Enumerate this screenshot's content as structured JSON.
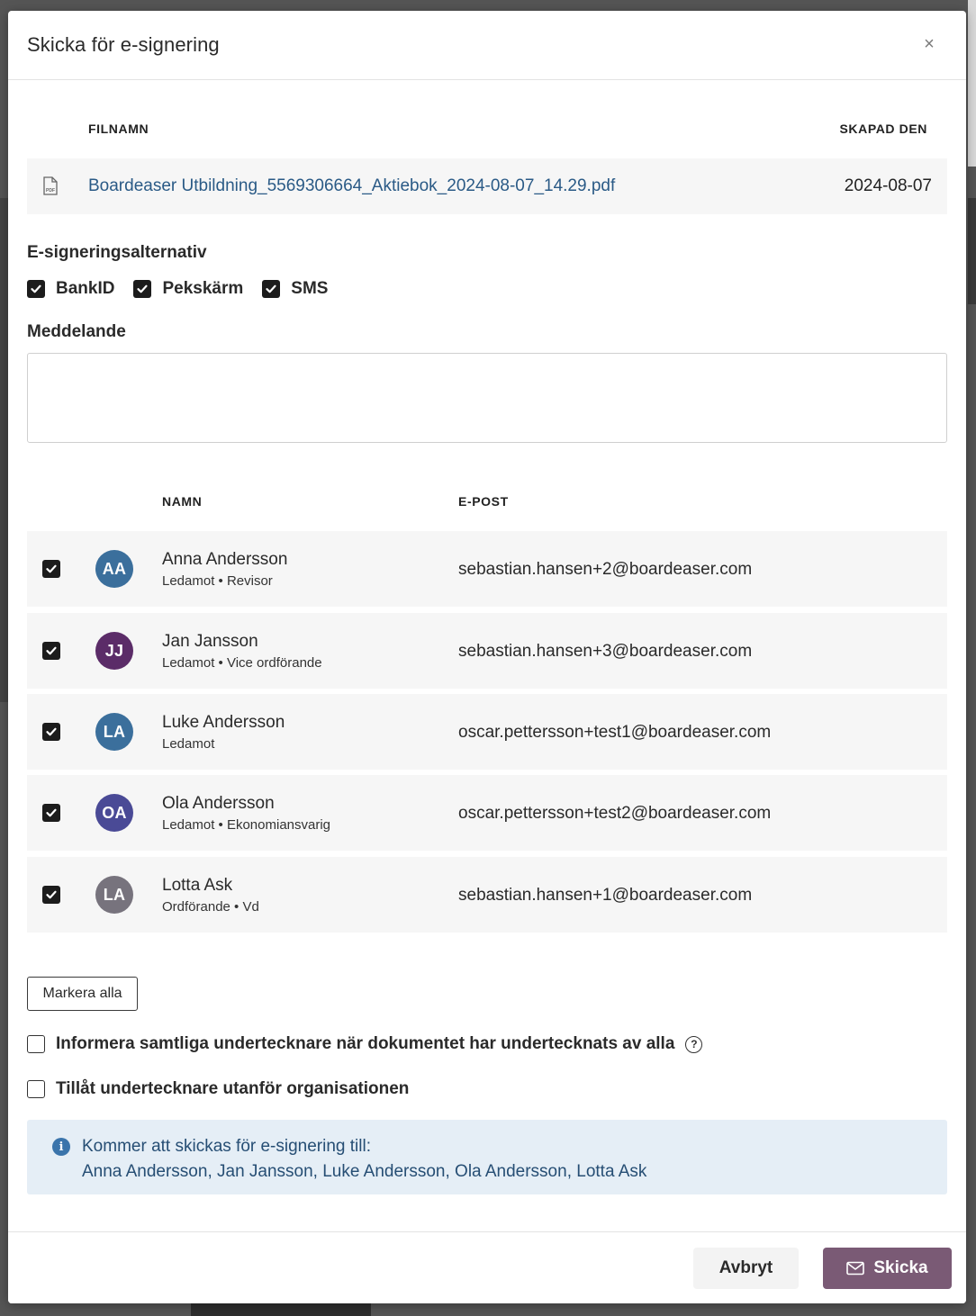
{
  "modal": {
    "title": "Skicka för e-signering",
    "close_glyph": "×"
  },
  "files": {
    "headers": {
      "name": "FILNAMN",
      "created": "SKAPAD DEN"
    },
    "rows": [
      {
        "icon": "pdf-file-icon",
        "name": "Boardeaser Utbildning_5569306664_Aktiebok_2024-08-07_14.29.pdf",
        "created": "2024-08-07"
      }
    ]
  },
  "signing_options": {
    "label": "E-signeringsalternativ",
    "options": [
      {
        "label": "BankID",
        "checked": true
      },
      {
        "label": "Pekskärm",
        "checked": true
      },
      {
        "label": "SMS",
        "checked": true
      }
    ]
  },
  "message": {
    "label": "Meddelande",
    "value": ""
  },
  "signers": {
    "headers": {
      "name": "NAMN",
      "email": "E-POST"
    },
    "rows": [
      {
        "checked": true,
        "initials": "AA",
        "avatar_color": "#3b6f9c",
        "name": "Anna Andersson",
        "role": "Ledamot • Revisor",
        "email": "sebastian.hansen+2@boardeaser.com"
      },
      {
        "checked": true,
        "initials": "JJ",
        "avatar_color": "#5b2c68",
        "name": "Jan Jansson",
        "role": "Ledamot • Vice ordförande",
        "email": "sebastian.hansen+3@boardeaser.com"
      },
      {
        "checked": true,
        "initials": "LA",
        "avatar_color": "#3b6f9c",
        "name": "Luke Andersson",
        "role": "Ledamot",
        "email": "oscar.pettersson+test1@boardeaser.com"
      },
      {
        "checked": true,
        "initials": "OA",
        "avatar_color": "#4a4a96",
        "name": "Ola Andersson",
        "role": "Ledamot • Ekonomiansvarig",
        "email": "oscar.pettersson+test2@boardeaser.com"
      },
      {
        "checked": true,
        "initials": "LA",
        "avatar_color": "#77737d",
        "name": "Lotta Ask",
        "role": "Ordförande • Vd",
        "email": "sebastian.hansen+1@boardeaser.com"
      }
    ]
  },
  "select_all_label": "Markera alla",
  "extra_options": [
    {
      "label": "Informera samtliga undertecknare när dokumentet har undertecknats av alla",
      "checked": false,
      "help": "?"
    },
    {
      "label": "Tillåt undertecknare utanför organisationen",
      "checked": false
    }
  ],
  "info": {
    "icon_glyph": "i",
    "title": "Kommer att skickas för e-signering till:",
    "names": "Anna Andersson, Jan Jansson, Luke Andersson, Ola Andersson, Lotta Ask"
  },
  "footer": {
    "cancel_label": "Avbryt",
    "send_label": "Skicka"
  }
}
